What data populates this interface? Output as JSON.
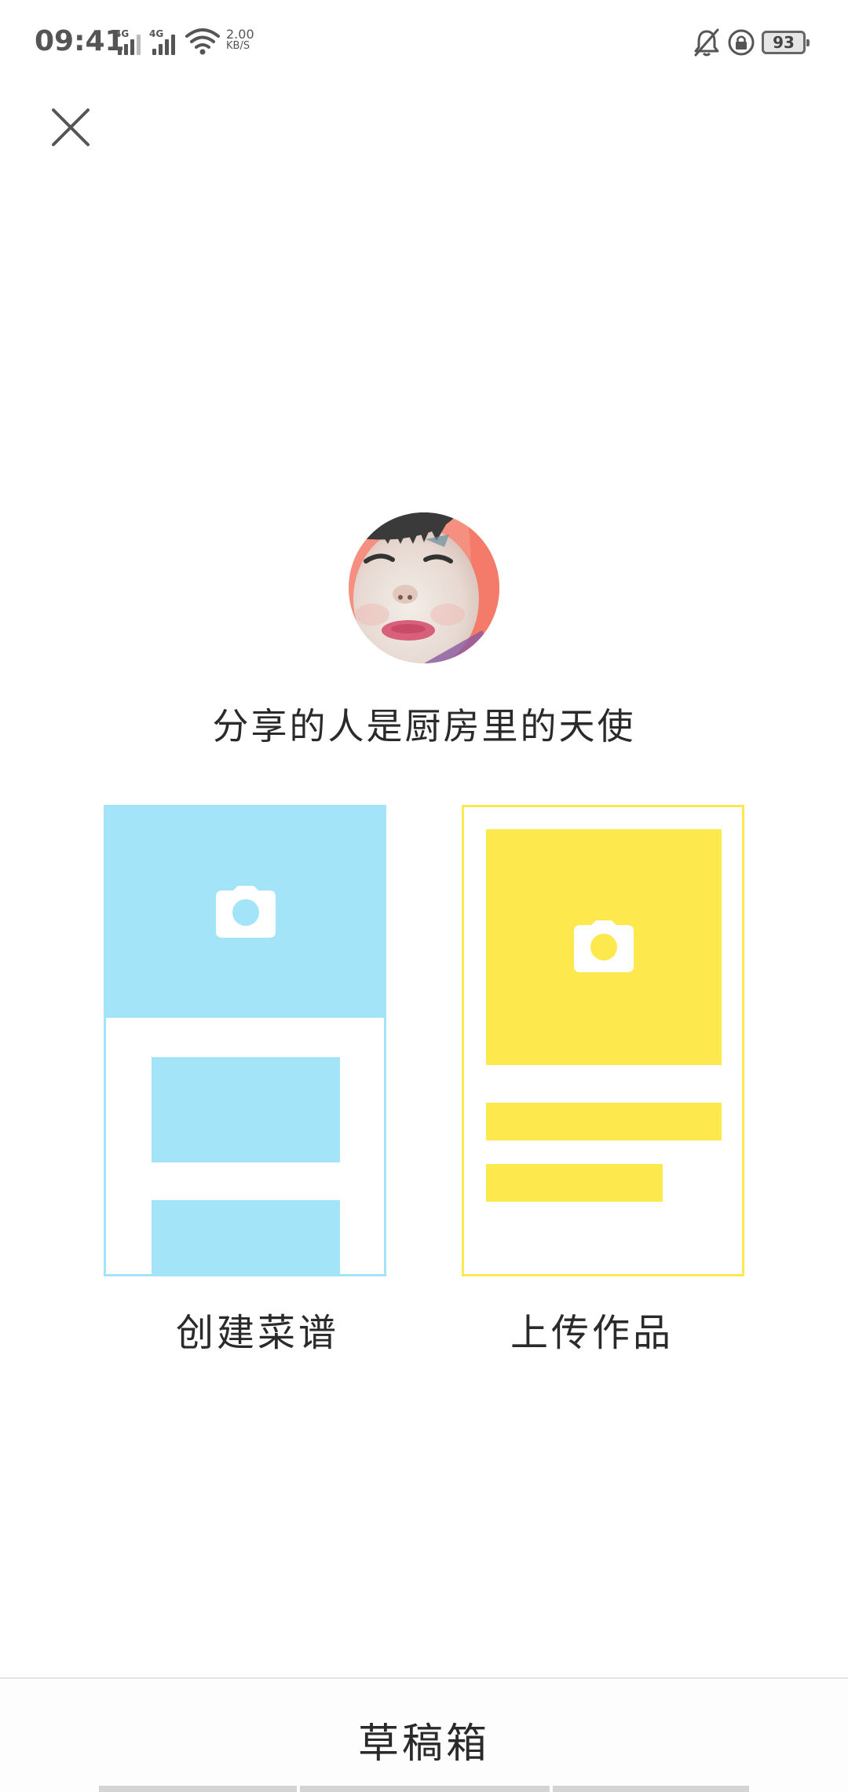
{
  "status_bar": {
    "time": "09:41",
    "network_1": "4G",
    "network_2": "4G",
    "speed_value": "2.00",
    "speed_unit": "KB/S",
    "battery": "93"
  },
  "header": {
    "close_icon": "close-icon"
  },
  "profile": {
    "avatar": "avatar",
    "slogan": "分享的人是厨房里的天使"
  },
  "options": [
    {
      "label": "创建菜谱",
      "icon": "camera-icon",
      "color": "#a3e4f9"
    },
    {
      "label": "上传作品",
      "icon": "camera-icon",
      "color": "#fde84e"
    }
  ],
  "drafts": {
    "label": "草稿箱"
  }
}
